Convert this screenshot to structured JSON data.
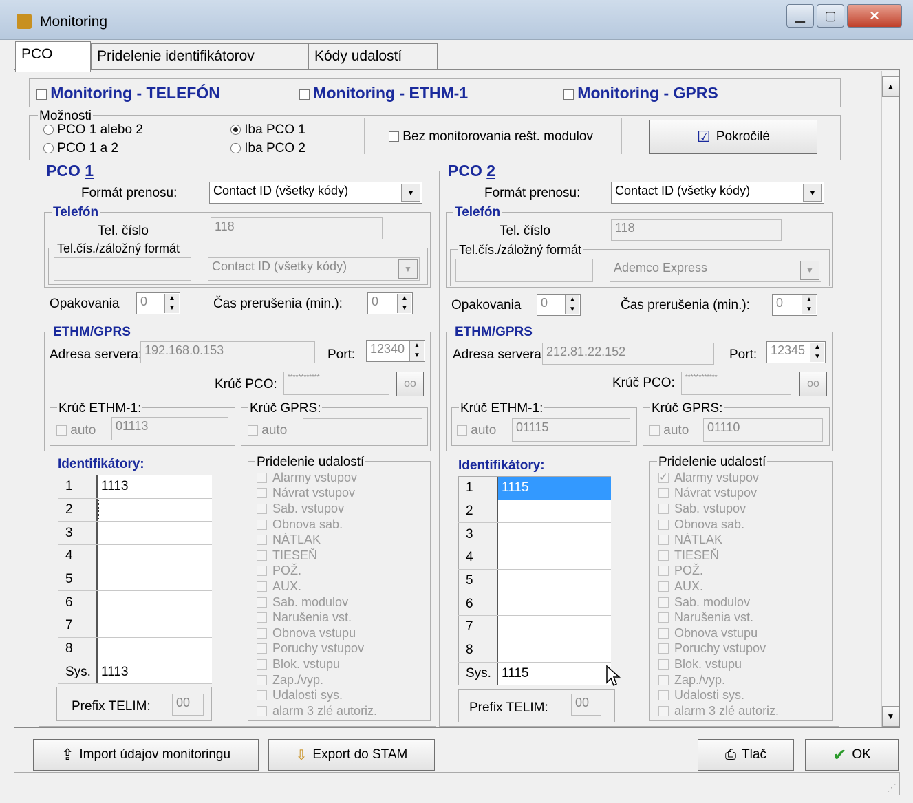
{
  "window": {
    "title": "Monitoring"
  },
  "tabs": [
    "PCO",
    "Pridelenie identifikátorov",
    "Kódy udalostí"
  ],
  "monitoring": {
    "telefon": "Monitoring - TELEFÓN",
    "ethm": "Monitoring - ETHM-1",
    "gprs": "Monitoring - GPRS"
  },
  "options": {
    "title": "Možnosti",
    "r1": "PCO 1 alebo 2",
    "r2": "PCO 1 a 2",
    "r3": "Iba PCO 1",
    "r4": "Iba PCO 2",
    "no_monitor": "Bez monitorovania rešt. modulov",
    "advanced": "Pokročilé"
  },
  "pco1": {
    "title_prefix": "PCO ",
    "title_num": "1",
    "format_label": "Formát prenosu:",
    "format_value": "Contact ID (všetky kódy)",
    "telefon_title": "Telefón",
    "tel_label": "Tel. číslo",
    "tel_value": "118",
    "backup_title": "Tel.čís./záložný formát",
    "backup_format": "Contact ID (všetky kódy)",
    "repeat_label": "Opakovania",
    "repeat_value": "0",
    "break_label": "Čas prerušenia (min.):",
    "break_value": "0",
    "ethm_title": "ETHM/GPRS",
    "server_label": "Adresa servera:",
    "server_value": "192.168.0.153",
    "port_label": "Port:",
    "port_value": "12340",
    "key_label": "Krúč PCO:",
    "key_value": "************",
    "key_ethm_title": "Krúč ETHM-1:",
    "key_ethm_value": "01113",
    "key_gprs_title": "Krúč GPRS:",
    "auto_label": "auto",
    "ids_title": "Identifikátory:",
    "ids": [
      {
        "k": "1",
        "v": "1113"
      },
      {
        "k": "2",
        "v": ""
      },
      {
        "k": "3",
        "v": ""
      },
      {
        "k": "4",
        "v": ""
      },
      {
        "k": "5",
        "v": ""
      },
      {
        "k": "6",
        "v": ""
      },
      {
        "k": "7",
        "v": ""
      },
      {
        "k": "8",
        "v": ""
      },
      {
        "k": "Sys.",
        "v": "1113"
      }
    ],
    "prefix_label": "Prefix TELIM:",
    "prefix_value": "00"
  },
  "pco2": {
    "title_prefix": "PCO ",
    "title_num": "2",
    "format_label": "Formát prenosu:",
    "format_value": "Contact ID (všetky kódy)",
    "telefon_title": "Telefón",
    "tel_label": "Tel. číslo",
    "tel_value": "118",
    "backup_title": "Tel.čís./záložný formát",
    "backup_format": "Ademco Express",
    "repeat_label": "Opakovania",
    "repeat_value": "0",
    "break_label": "Čas prerušenia (min.):",
    "break_value": "0",
    "ethm_title": "ETHM/GPRS",
    "server_label": "Adresa servera",
    "server_value": "212.81.22.152",
    "port_label": "Port:",
    "port_value": "12345",
    "key_label": "Krúč PCO:",
    "key_value": "************",
    "key_ethm_title": "Krúč ETHM-1:",
    "key_ethm_value": "01115",
    "key_gprs_title": "Krúč GPRS:",
    "key_gprs_value": "01110",
    "auto_label": "auto",
    "ids_title": "Identifikátory:",
    "ids": [
      {
        "k": "1",
        "v": "1115"
      },
      {
        "k": "2",
        "v": ""
      },
      {
        "k": "3",
        "v": ""
      },
      {
        "k": "4",
        "v": ""
      },
      {
        "k": "5",
        "v": ""
      },
      {
        "k": "6",
        "v": ""
      },
      {
        "k": "7",
        "v": ""
      },
      {
        "k": "8",
        "v": ""
      },
      {
        "k": "Sys.",
        "v": "1115"
      }
    ],
    "prefix_label": "Prefix TELIM:",
    "prefix_value": "00"
  },
  "events": {
    "title": "Pridelenie udalostí",
    "items": [
      "Alarmy vstupov",
      "Návrat vstupov",
      "Sab. vstupov",
      "Obnova sab.",
      "NÁTLAK",
      "TIESEŇ",
      "POŽ.",
      "AUX.",
      "Sab. modulov",
      "Narušenia vst.",
      "Obnova vstupu",
      "Poruchy vstupov",
      "Blok. vstupu",
      "Zap./vyp.",
      "Udalosti sys.",
      "alarm 3 zlé autoriz."
    ]
  },
  "footer": {
    "import": "Import údajov monitoringu",
    "export": "Export do STAM",
    "print": "Tlač",
    "ok": "OK"
  },
  "colors": {
    "accent": "#1a2a9c",
    "selection": "#3399ff"
  }
}
